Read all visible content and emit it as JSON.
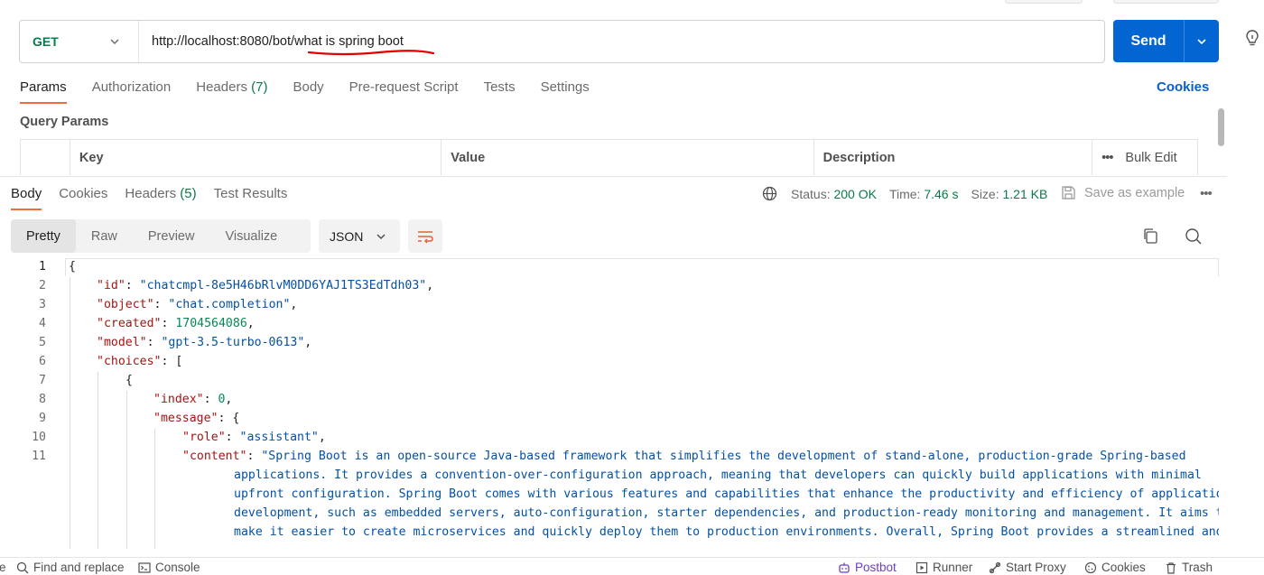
{
  "request": {
    "method": "GET",
    "url_base": "http://localhost:8080/bot/",
    "url_path": "what is spring boot",
    "send_label": "Send"
  },
  "request_tabs": [
    {
      "label": "Params"
    },
    {
      "label": "Authorization"
    },
    {
      "label": "Headers",
      "count": "(7)"
    },
    {
      "label": "Body"
    },
    {
      "label": "Pre-request Script"
    },
    {
      "label": "Tests"
    },
    {
      "label": "Settings"
    }
  ],
  "cookies_link": "Cookies",
  "query_params": {
    "title": "Query Params",
    "columns": [
      "Key",
      "Value",
      "Description"
    ],
    "bulk_edit": "Bulk Edit"
  },
  "response_tabs": [
    {
      "label": "Body"
    },
    {
      "label": "Cookies"
    },
    {
      "label": "Headers",
      "count": "(5)"
    },
    {
      "label": "Test Results"
    }
  ],
  "status": {
    "status_label": "Status:",
    "status_value": "200 OK",
    "time_label": "Time:",
    "time_value": "7.46 s",
    "size_label": "Size:",
    "size_value": "1.21 KB",
    "save_example": "Save as example"
  },
  "format_tabs": [
    "Pretty",
    "Raw",
    "Preview",
    "Visualize"
  ],
  "format_select": "JSON",
  "code": {
    "line_numbers": [
      "1",
      "2",
      "3",
      "4",
      "5",
      "6",
      "7",
      "8",
      "9",
      "10",
      "11"
    ],
    "open_brace": "{",
    "id_key": "\"id\"",
    "id_value": "\"chatcmpl-8e5H46bRlvM0DD6YAJ1TS3EdTdh03\"",
    "object_key": "\"object\"",
    "object_value": "\"chat.completion\"",
    "created_key": "\"created\"",
    "created_value": "1704564086",
    "model_key": "\"model\"",
    "model_value": "\"gpt-3.5-turbo-0613\"",
    "choices_key": "\"choices\"",
    "index_key": "\"index\"",
    "index_value": "0",
    "message_key": "\"message\"",
    "role_key": "\"role\"",
    "role_value": "\"assistant\"",
    "content_key": "\"content\"",
    "content_lines": [
      "\"Spring Boot is an open-source Java-based framework that simplifies the development of stand-alone, production-grade Spring-based",
      "applications. It provides a convention-over-configuration approach, meaning that developers can quickly build applications with minimal",
      "upfront configuration. Spring Boot comes with various features and capabilities that enhance the productivity and efficiency of application",
      "development, such as embedded servers, auto-configuration, starter dependencies, and production-ready monitoring and management. It aims to",
      "make it easier to create microservices and quickly deploy them to production environments. Overall, Spring Boot provides a streamlined and"
    ]
  },
  "footer": {
    "find_replace": "Find and replace",
    "console": "Console",
    "postbot": "Postbot",
    "runner": "Runner",
    "start_proxy": "Start Proxy",
    "cookies": "Cookies",
    "trash": "Trash",
    "left_cut": "e"
  }
}
